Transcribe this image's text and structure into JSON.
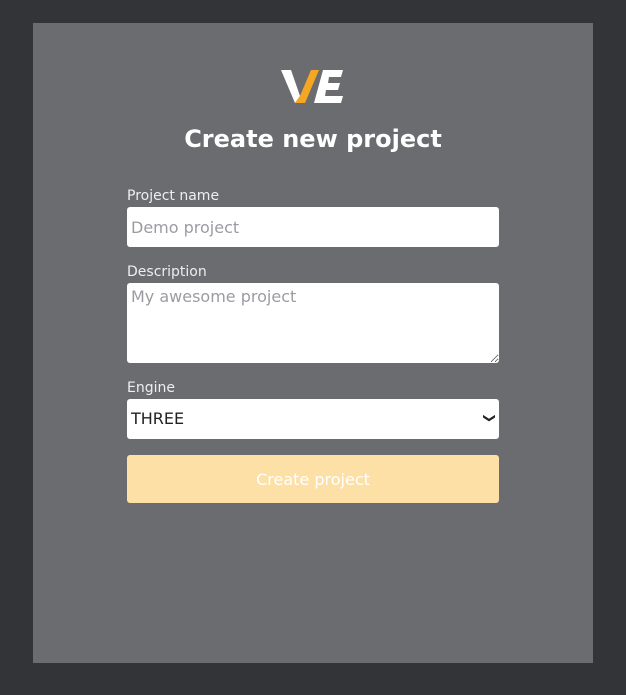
{
  "page": {
    "title": "Create new project"
  },
  "logo": {
    "icon": "ve-logo-icon",
    "colors": {
      "white": "#ffffff",
      "accent": "#f5a623"
    }
  },
  "form": {
    "project_name": {
      "label": "Project name",
      "placeholder": "Demo project",
      "value": ""
    },
    "description": {
      "label": "Description",
      "placeholder": "My awesome project",
      "value": ""
    },
    "engine": {
      "label": "Engine",
      "selected": "THREE",
      "icon": "chevron-down-icon"
    },
    "submit_label": "Create project"
  },
  "colors": {
    "background": "#323438",
    "panel": "#6b6c70",
    "button": "#fde0a5",
    "button_text": "#ffffff"
  }
}
